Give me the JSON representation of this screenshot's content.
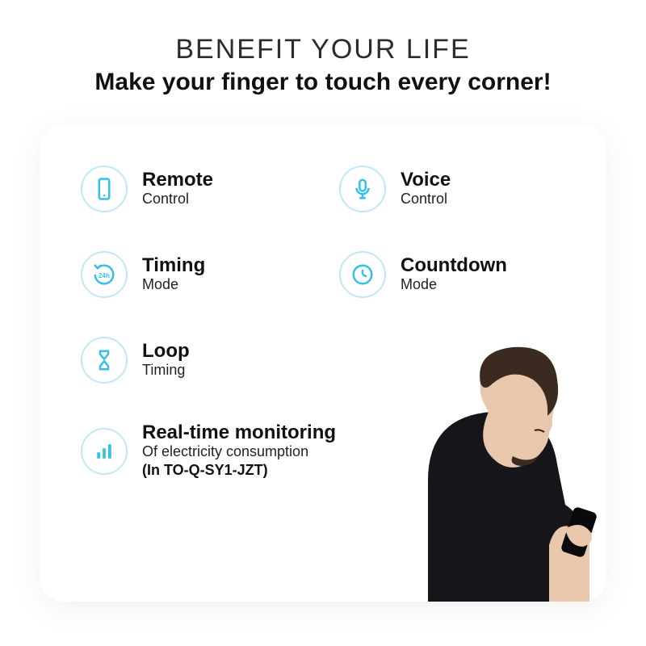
{
  "header": {
    "title": "BENEFIT YOUR LIFE",
    "subtitle": "Make your finger to touch every corner!"
  },
  "features": [
    {
      "icon": "phone",
      "title": "Remote",
      "sub": "Control",
      "note": ""
    },
    {
      "icon": "mic",
      "title": "Voice",
      "sub": "Control",
      "note": ""
    },
    {
      "icon": "clock24",
      "title": "Timing",
      "sub": "Mode",
      "note": ""
    },
    {
      "icon": "countdown",
      "title": "Countdown",
      "sub": "Mode",
      "note": ""
    },
    {
      "icon": "hourglass",
      "title": "Loop",
      "sub": "Timing",
      "note": ""
    },
    {
      "icon": "bars",
      "title": "Real-time monitoring",
      "sub": "Of electricity consumption",
      "note": "(In TO-Q-SY1-JZT)"
    }
  ],
  "accent_color": "#35c0ea"
}
